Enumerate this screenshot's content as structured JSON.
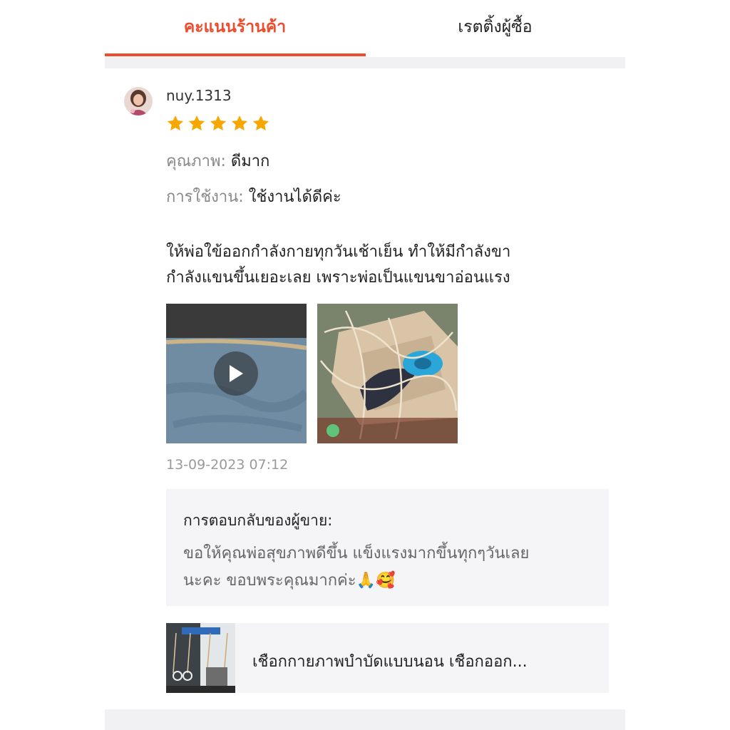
{
  "tabs": [
    {
      "label": "คะแนนร้านค้า",
      "active": true
    },
    {
      "label": "เรตติ้งผู้ซื้อ",
      "active": false
    }
  ],
  "accent_color": "#ee4d2d",
  "review": {
    "username": "nuy.1313",
    "rating": 5,
    "rating_max": 5,
    "quality_label": "คุณภาพ:",
    "quality_value": "ดีมาก",
    "usage_label": "การใช้งาน:",
    "usage_value": "ใช้งานได้ดีค่ะ",
    "comment_line1": "ให้พ่อใข้ออกกำลังกายทุกวันเช้าเย็น ทำให้มีกำลังขา",
    "comment_line2": "กำลังแขนขึ้นเยอะเลย เพราะพ่อเป็นแขนขาอ่อนแรง",
    "media": [
      {
        "type": "video",
        "icon": "play-icon"
      },
      {
        "type": "image"
      }
    ],
    "date": "13-09-2023 07:12"
  },
  "seller_reply": {
    "title": "การตอบกลับของผู้ขาย:",
    "line1": "ขอให้คุณพ่อสุขภาพดีขึ้น แข็งแรงมากขึ้นทุกๆวันเลย",
    "line2": "นะคะ ขอบพระคุณมากค่ะ",
    "emoji": [
      "🙏",
      "🥰"
    ]
  },
  "product": {
    "name": "เชือกกายภาพบำบัดแบบนอน เชือกออก..."
  }
}
